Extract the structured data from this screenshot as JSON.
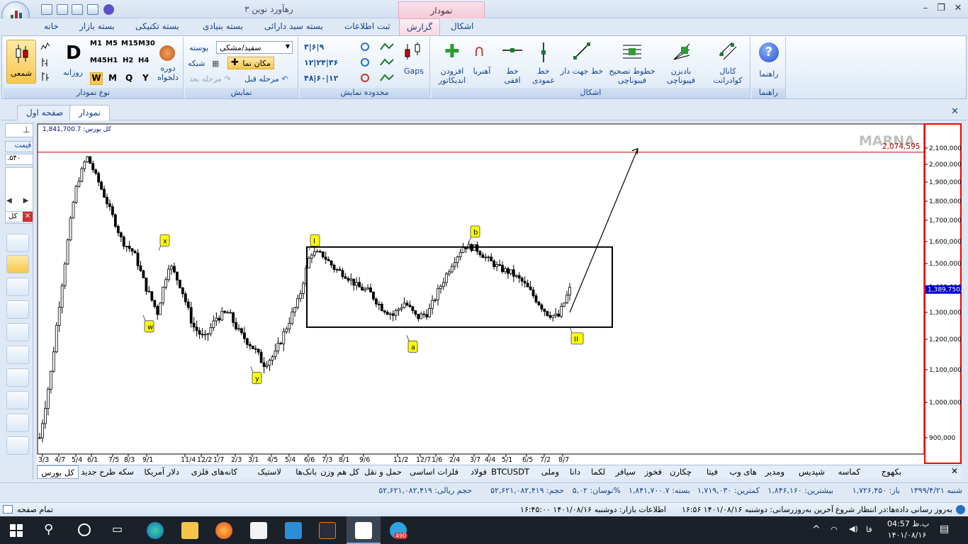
{
  "app": {
    "title": "رهآورد نوین ۳",
    "context_tab": "نمودار"
  },
  "tabs": [
    "خانه",
    "بسته بازار",
    "بسته تکنیکی",
    "بسته بنیادی",
    "بسته سبد دارائی",
    "ثبت اطلاعات",
    "گزارش",
    "اشکال"
  ],
  "active_tab_index": 6,
  "ribbon": {
    "chart_type": {
      "label": "نوع نمودار",
      "candle": "شمعی",
      "daily": "روزانه",
      "d_letter": "D",
      "arbitrary_period": "دوره دلخواه",
      "timeframes": [
        "M1",
        "M5",
        "M15",
        "M30",
        "M45",
        "H1",
        "H2",
        "H4"
      ],
      "periods": [
        "W",
        "M",
        "Q",
        "Y"
      ]
    },
    "display": {
      "label": "نمایش",
      "skin": "پوسته",
      "skin_value": "سفید/مشکی",
      "grid": "شبکه",
      "cursor": "مکان نما",
      "prev_step": "مرحله قبل",
      "next_step": "مرحله بعد"
    },
    "display_range": {
      "label": "محدوده نمایش",
      "gaps": "Gaps"
    },
    "shapes": {
      "label": "اشکال",
      "add_indicator": "افزودن اندیکاتور",
      "magnet": "آهنربا",
      "hline": "خط افقی",
      "vline": "خط عمودی",
      "trendline": "خط جهت دار",
      "fib_retrace": "خطوط تصحیح فیبوناچی",
      "fib_fan": "بادبزن فیبوناچی",
      "quad_channel": "کانال کوادرانت"
    },
    "help": {
      "label": "راهنما",
      "btn": "راهنما"
    }
  },
  "doc_tabs": [
    "صفحه اول",
    "نمودار"
  ],
  "left_panel": {
    "price_header": "قیمت",
    "price_value": ".۵۴۰",
    "all_label": "کل"
  },
  "chart": {
    "index_name_label": "کل بورس: 1,841,700.7",
    "watermark": "MARNA",
    "hline_label": "2,074,595",
    "current_price_label": "1,389,750.2",
    "y_ticks": [
      "2,100,000",
      "2,000,000",
      "1,900,000",
      "1,800,000",
      "1,700,000",
      "1,600,000",
      "1,500,000",
      "1,400,000",
      "1,300,000",
      "1,200,000",
      "1,100,000",
      "1,000,000",
      "900,000"
    ],
    "x_ticks": [
      "3/3",
      "4/7",
      "5/4",
      "6/1",
      "7/5",
      "8/3",
      "9/1",
      "11/4",
      "12/2",
      "1/7",
      "2/3",
      "3/1",
      "4/5",
      "5/4",
      "6/6",
      "7/3",
      "8/1",
      "9/6",
      "11/2",
      "12/7",
      "1/6",
      "2/4",
      "3/7",
      "4/4",
      "5/1",
      "6/5",
      "7/2",
      "8/7"
    ],
    "wave_labels": [
      "w",
      "x",
      "y",
      "I",
      "a",
      "b",
      "II"
    ],
    "colors": {
      "candle": "#000000",
      "hline": "#c00000",
      "border": "#ff0000",
      "price_tag": "#0000cc",
      "tag": "#ffff00"
    }
  },
  "chart_data": {
    "type": "candlestick",
    "title": "کل بورس",
    "ylim": [
      850000,
      2200000
    ],
    "resistance_line": 2074595,
    "last_price": 1389750.2,
    "header_value": 1841700.7,
    "rectangle": {
      "top": 1575000,
      "bottom": 1245000
    },
    "wave_labels": [
      {
        "label": "w",
        "value": 1290000
      },
      {
        "label": "x",
        "value": 1560000
      },
      {
        "label": "y",
        "value": 1110000
      },
      {
        "label": "I",
        "value": 1560000
      },
      {
        "label": "a",
        "value": 1215000
      },
      {
        "label": "b",
        "value": 1600000
      },
      {
        "label": "II",
        "value": 1245000
      }
    ],
    "approx_closes": [
      900000,
      1100000,
      1450000,
      1850000,
      2050000,
      1900000,
      1750000,
      1600000,
      1550000,
      1400000,
      1300000,
      1500000,
      1400000,
      1250000,
      1200000,
      1280000,
      1300000,
      1220000,
      1180000,
      1120000,
      1150000,
      1250000,
      1350000,
      1550000,
      1540000,
      1480000,
      1450000,
      1400000,
      1380000,
      1320000,
      1290000,
      1340000,
      1280000,
      1300000,
      1400000,
      1500000,
      1580000,
      1570000,
      1520000,
      1480000,
      1460000,
      1420000,
      1360000,
      1300000,
      1280000,
      1390000
    ]
  },
  "symbol_tabs": [
    "کل بورس",
    "سکه طرح جدید",
    "دلار آمریکا",
    "کانه‌های فلزی",
    "لاستیک",
    "بانک‌ها",
    "کل هم وزن",
    "حمل و نقل",
    "فلزات اساسی",
    "فولاد",
    "BTCUSDT",
    "وملی",
    "دانا",
    "لکما",
    "سیافر",
    "فخوز",
    "چکارن",
    "فیتا",
    "های وب",
    "ومدیر",
    "شپدیس",
    "کماسه",
    "بکهوج"
  ],
  "info_bar": [
    "شنبه ۱۳۹۹/۴/۲۱",
    "باز: ۱,۷۲۶,۴۵۰",
    "بیشترین: ۱,۸۴۶,۱۶۰",
    "کمترین: ۱,۷۱۹,۰۳۰",
    "بسته: ۱,۸۴۱,۷۰۰.۷",
    "نوسان: ۵,۰۲%",
    "حجم: ۵۲,۶۲۱,۰۸۲,۴۱۹",
    "حجم ریالی: ۵۲,۶۲۱,۰۸۲,۴۱۹"
  ],
  "status": {
    "left": "تمام صفحه",
    "market": "اطلاعات بازار: دوشنبه ۱۴۰۱/۰۸/۱۶ ۱۶:۴۵:۰۰",
    "last_update": "آخرین به‌روزرسانی: دوشنبه ۱۴۰۱/۰۸/۱۶ ۱۶:۵۶",
    "waiting": "به‌روز رسانی داده‌ها:در انتظار شروع"
  },
  "taskbar": {
    "time": "04:57 ب.ظ",
    "date": "۱۴۰۱/۰۸/۱۶",
    "lang": "فا",
    "badge": "490"
  }
}
